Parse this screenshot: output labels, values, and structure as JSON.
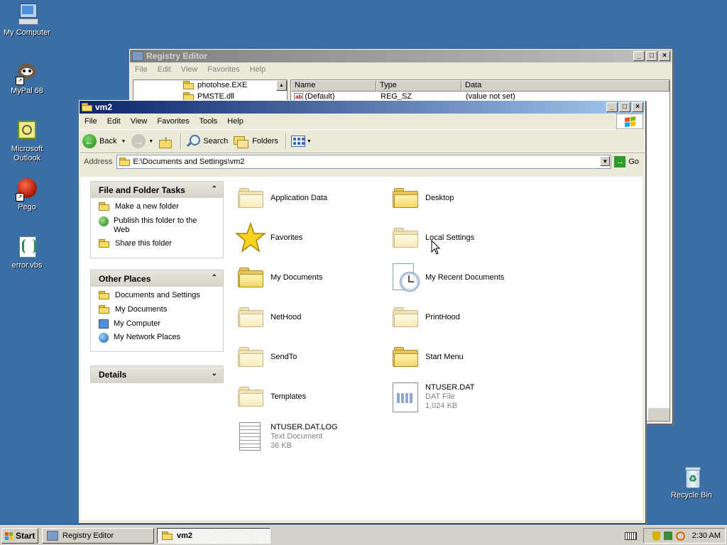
{
  "desktop": {
    "icons": [
      {
        "label": "My Computer",
        "icon": "computer-icon"
      },
      {
        "label": "MyPal 68",
        "icon": "mypal-browser-icon"
      },
      {
        "label": "Microsoft Outlook",
        "icon": "outlook-icon"
      },
      {
        "label": "Pego",
        "icon": "pego-icon"
      },
      {
        "label": "error.vbs",
        "icon": "vbs-script-icon"
      },
      {
        "label": "Recycle Bin",
        "icon": "recycle-bin-icon"
      }
    ]
  },
  "registry": {
    "title": "Registry Editor",
    "menu": [
      "File",
      "Edit",
      "View",
      "Favorites",
      "Help"
    ],
    "tree_items": [
      "photohse.EXE",
      "PMSTE.dll"
    ],
    "columns": [
      "Name",
      "Type",
      "Data"
    ],
    "row": {
      "name": "(Default)",
      "type": "REG_SZ",
      "data": "(value not set)"
    }
  },
  "explorer": {
    "title": "vm2",
    "menu": [
      "File",
      "Edit",
      "View",
      "Favorites",
      "Tools",
      "Help"
    ],
    "toolbar": {
      "back": "Back",
      "search": "Search",
      "folders": "Folders"
    },
    "address": {
      "label": "Address",
      "value": "E:\\Documents and Settings\\vm2",
      "go": "Go"
    },
    "tasks": {
      "title": "File and Folder Tasks",
      "items": [
        "Make a new folder",
        "Publish this folder to the Web",
        "Share this folder"
      ]
    },
    "places": {
      "title": "Other Places",
      "items": [
        "Documents and Settings",
        "My Documents",
        "My Computer",
        "My Network Places"
      ]
    },
    "details": {
      "title": "Details"
    },
    "files": [
      {
        "name": "Application Data",
        "kind": "folder-faded"
      },
      {
        "name": "Desktop",
        "kind": "folder"
      },
      {
        "name": "Favorites",
        "kind": "star"
      },
      {
        "name": "Local Settings",
        "kind": "folder-faded"
      },
      {
        "name": "My Documents",
        "kind": "folder"
      },
      {
        "name": "My Recent Documents",
        "kind": "recent"
      },
      {
        "name": "NetHood",
        "kind": "folder-faded"
      },
      {
        "name": "PrintHood",
        "kind": "folder-faded"
      },
      {
        "name": "SendTo",
        "kind": "folder-faded"
      },
      {
        "name": "Start Menu",
        "kind": "folder"
      },
      {
        "name": "Templates",
        "kind": "folder-faded"
      },
      {
        "name": "NTUSER.DAT",
        "kind": "dat",
        "type": "DAT File",
        "size": "1,024 KB"
      },
      {
        "name": "NTUSER.DAT.LOG",
        "kind": "txt",
        "type": "Text Document",
        "size": "36 KB"
      }
    ]
  },
  "taskbar": {
    "start": "Start",
    "buttons": [
      "Registry Editor",
      "vm2"
    ],
    "clock": "2:30 AM"
  },
  "colors": {
    "desktop": "#3a6ea5",
    "title_active": "#0a246a",
    "folder": "#f3d86a"
  }
}
